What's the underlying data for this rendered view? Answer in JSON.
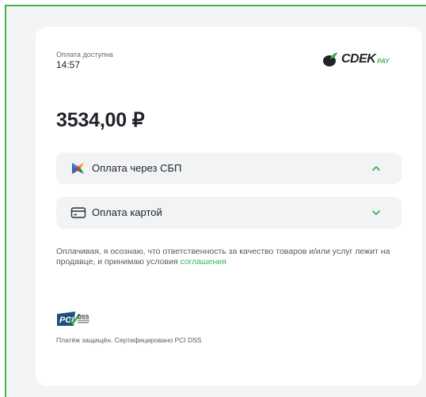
{
  "header": {
    "availability_label": "Оплата доступна",
    "availability_time": "14:57"
  },
  "logo": {
    "brand": "CDEK",
    "suffix": "PAY"
  },
  "payment": {
    "amount": "3534,00 ₽"
  },
  "methods": [
    {
      "label": "Оплата через СБП",
      "icon": "sbp-logo-icon",
      "chevron": "chevron-up-icon"
    },
    {
      "label": "Оплата картой",
      "icon": "credit-card-icon",
      "chevron": "chevron-down-icon"
    }
  ],
  "consent": {
    "text": "Оплачивая, я осознаю, что ответственность за качество товаров и/или услуг лежит на продавце, и принимаю условия ",
    "link_text": "соглашения"
  },
  "security": {
    "badge": "PCI DSS",
    "note": "Платёж защищён. Сертифицировано PCI DSS"
  },
  "colors": {
    "accent": "#3fb15b",
    "background": "#f3f4f4",
    "card": "#ffffff",
    "method_bg": "#f2f3f4",
    "text": "#1f2327"
  }
}
